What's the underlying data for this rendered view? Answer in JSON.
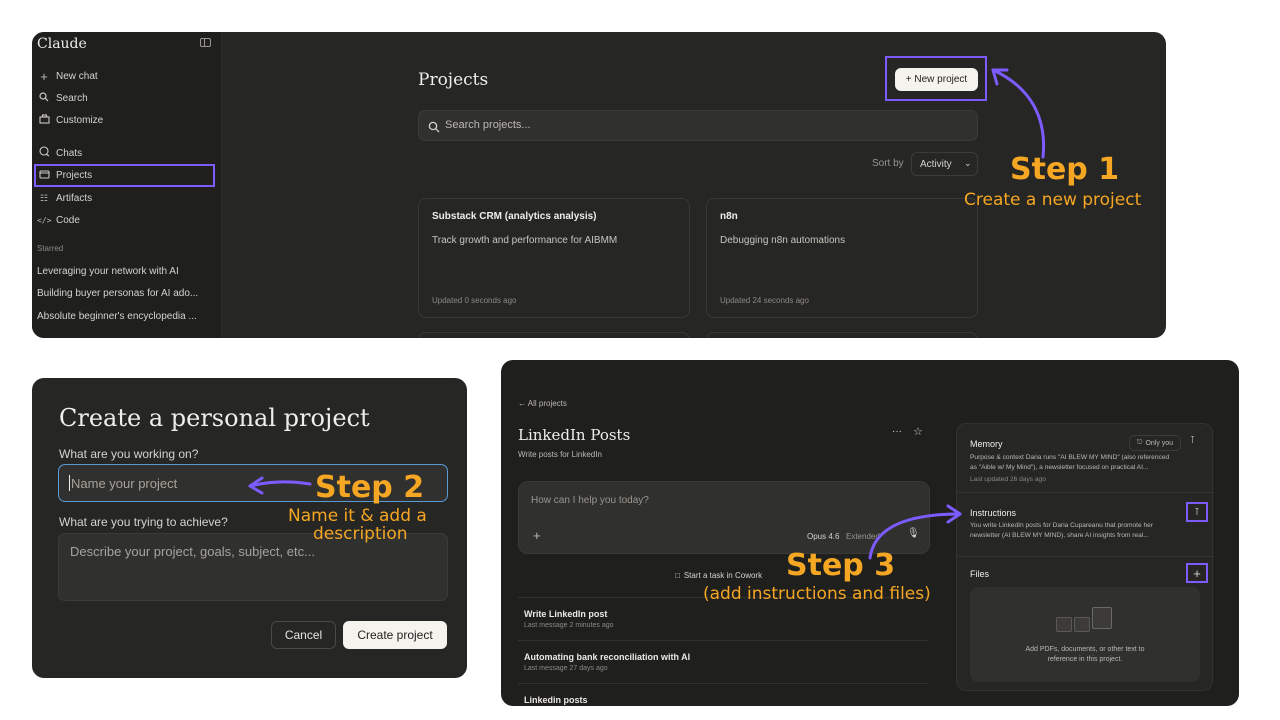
{
  "top_panel": {
    "app_name": "Claude",
    "sidebar": {
      "items": [
        {
          "label": "New chat",
          "icon": "plus-icon"
        },
        {
          "label": "Search",
          "icon": "search-icon"
        },
        {
          "label": "Customize",
          "icon": "briefcase-icon"
        },
        {
          "label": "Chats",
          "icon": "chat-bubble-icon"
        },
        {
          "label": "Projects",
          "icon": "folder-icon"
        },
        {
          "label": "Artifacts",
          "icon": "grid-icon"
        },
        {
          "label": "Code",
          "icon": "code-icon"
        }
      ],
      "starred_heading": "Starred",
      "starred": [
        "Leveraging your network with AI",
        "Building buyer personas for AI ado...",
        "Absolute beginner's encyclopedia ..."
      ]
    },
    "main": {
      "title": "Projects",
      "new_project_button": "+ New project",
      "search_placeholder": "Search projects...",
      "sort_label": "Sort by",
      "sort_value": "Activity",
      "cards": [
        {
          "title": "Substack CRM (analytics analysis)",
          "description": "Track growth and performance for AIBMM",
          "updated": "Updated 0 seconds ago"
        },
        {
          "title": "n8n",
          "description": "Debugging n8n automations",
          "updated": "Updated 24 seconds ago"
        }
      ]
    }
  },
  "dialog": {
    "title": "Create a personal project",
    "name_label": "What are you working on?",
    "name_placeholder": "Name your project",
    "desc_label": "What are you trying to achieve?",
    "desc_placeholder": "Describe your project, goals, subject, etc...",
    "cancel": "Cancel",
    "create": "Create project"
  },
  "project_view": {
    "back_link": "← All projects",
    "title": "LinkedIn Posts",
    "subtitle": "Write posts for LinkedIn",
    "chat_placeholder": "How can I help you today?",
    "model": "Opus 4.6",
    "mode": "Extended",
    "cowork_link": "Start a task in Cowork",
    "chats": [
      {
        "title": "Write LinkedIn post",
        "sub": "Last message 2 minutes ago"
      },
      {
        "title": "Automating bank reconciliation with AI",
        "sub": "Last message 27 days ago"
      },
      {
        "title": "Linkedin posts",
        "sub": ""
      }
    ],
    "memory": {
      "heading": "Memory",
      "badge": "Only you",
      "text_line1": "Purpose & context Daria runs \"AI BLEW MY MIND\" (also referenced",
      "text_line2": "as \"Aible w/ My Mind\"), a newsletter focused on practical AI...",
      "updated": "Last updated 26 days ago"
    },
    "instructions": {
      "heading": "Instructions",
      "text_line1": "You write LinkedIn posts for Daria Cupareanu that promote her",
      "text_line2": "newsletter (AI BLEW MY MIND), share AI insights from real..."
    },
    "files": {
      "heading": "Files",
      "empty_line1": "Add PDFs, documents, or other text to",
      "empty_line2": "reference in this project."
    }
  },
  "annotations": {
    "step1": "Step 1",
    "step1_sub": "Create a new project",
    "step2": "Step 2",
    "step2_sub1": "Name it & add a",
    "step2_sub2": "description",
    "step3": "Step 3",
    "step3_sub": "(add instructions and files)"
  },
  "colors": {
    "highlight": "#7c5cff",
    "annotation": "#f5a623"
  }
}
